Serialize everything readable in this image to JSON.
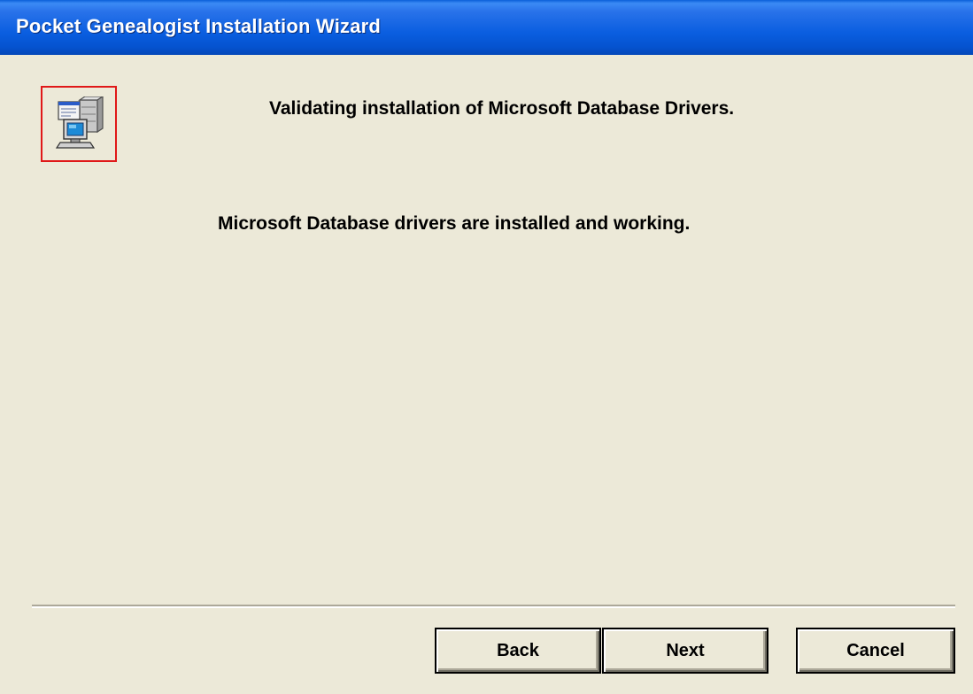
{
  "window": {
    "title": "Pocket Genealogist Installation Wizard"
  },
  "content": {
    "heading": "Validating installation of Microsoft Database Drivers.",
    "status_message": "Microsoft Database drivers are installed and working.",
    "icon": "database-server-computer-icon"
  },
  "buttons": {
    "back_label": "Back",
    "next_label": "Next",
    "cancel_label": "Cancel"
  },
  "colors": {
    "title_bar": "#0a5ee0",
    "dialog_background": "#ece9d8",
    "icon_highlight_border": "#e01818"
  }
}
